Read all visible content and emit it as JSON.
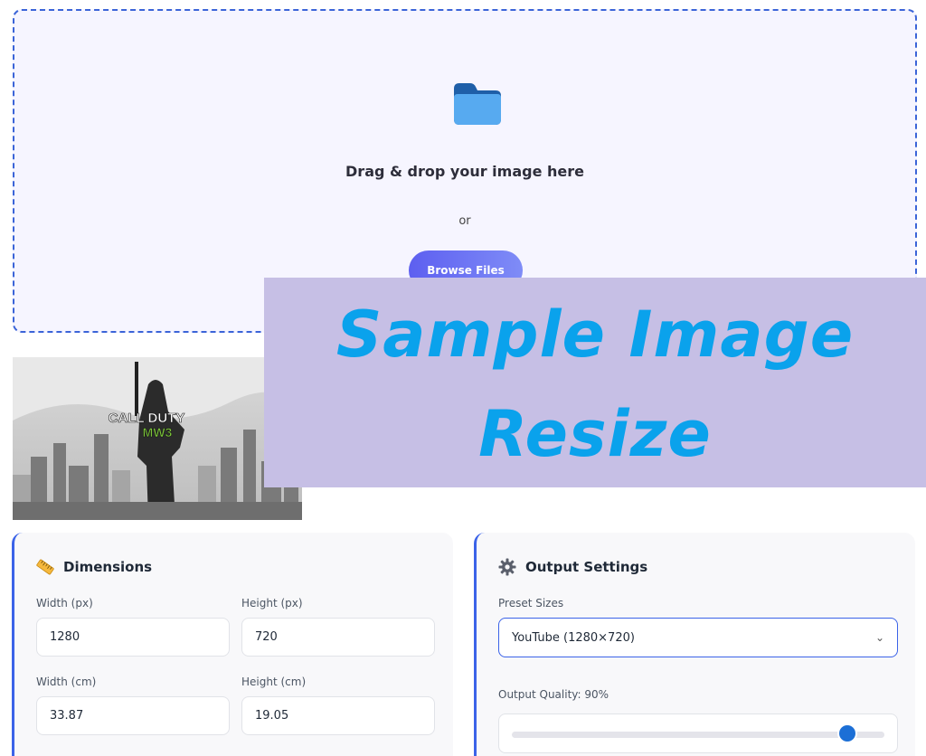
{
  "upload": {
    "title": "Drag & drop your image here",
    "or_text": "or",
    "browse_label": "Browse Files",
    "icon": "folder-icon"
  },
  "banner": {
    "line1": "Sample Image",
    "line2": "Resize"
  },
  "preview": {
    "logo_line1": "CALL DUTY",
    "logo_line2": "MW3"
  },
  "dimensions": {
    "title": "Dimensions",
    "icon": "ruler-icon",
    "width_px_label": "Width (px)",
    "width_px_value": "1280",
    "height_px_label": "Height (px)",
    "height_px_value": "720",
    "width_cm_label": "Width (cm)",
    "width_cm_value": "33.87",
    "height_cm_label": "Height (cm)",
    "height_cm_value": "19.05"
  },
  "output": {
    "title": "Output Settings",
    "icon": "gear-icon",
    "preset_label": "Preset Sizes",
    "preset_value": "YouTube (1280×720)",
    "quality_label": "Output Quality: 90%",
    "quality_percent": 90
  },
  "colors": {
    "accent": "#3b63e8",
    "banner_bg": "#c6bfe5",
    "banner_text": "#0aa2ec"
  }
}
